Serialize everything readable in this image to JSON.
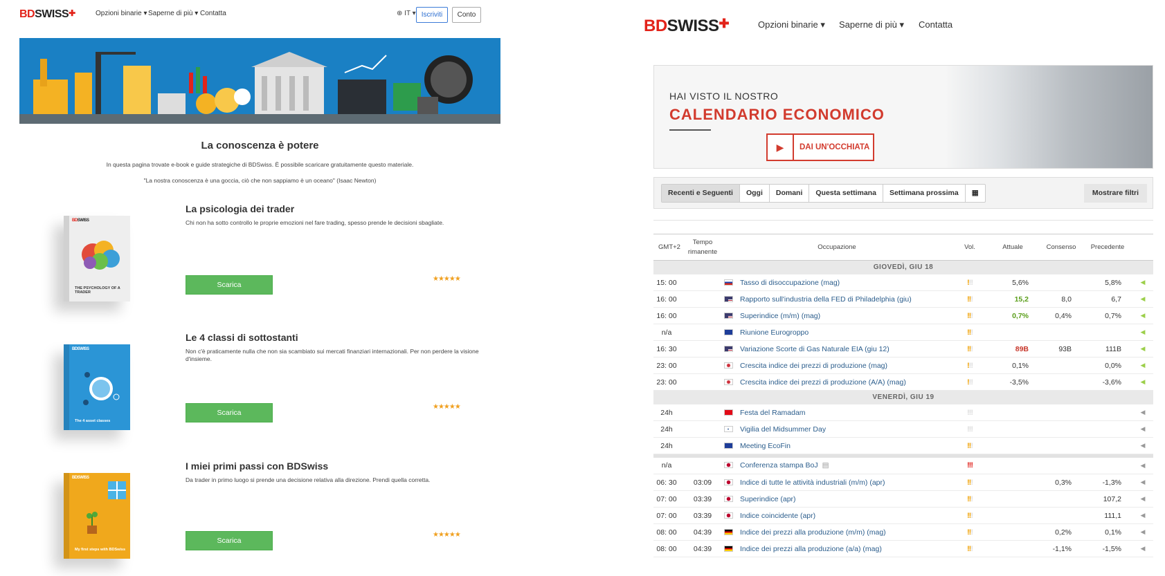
{
  "left": {
    "logo": {
      "bd": "BD",
      "swiss": "SWISS"
    },
    "nav": [
      "Opzioni binarie",
      "Saperne di più",
      "Contatta"
    ],
    "lang": "IT",
    "register_label": "Iscriviti",
    "account_label": "Conto",
    "heading": "La conoscenza è potere",
    "intro": "In questa pagina trovate e-book e guide strategiche di BDSwiss. È possibile scaricare gratuitamente questo materiale.",
    "quote": "\"La nostra conoscenza è una goccia, ciò che non sappiamo è un oceano\" (Isaac Newton)",
    "ebooks": [
      {
        "title": "La psicologia dei trader",
        "desc": "Chi non ha sotto controllo le proprie emozioni nel fare trading, spesso prende le decisioni sbagliate.",
        "button": "Scarica",
        "cover_text": "THE PSYCHOLOGY OF A TRADER",
        "cover_color": "#eeeeee",
        "rating": "★★★★★"
      },
      {
        "title": "Le 4 classi di sottostanti",
        "desc": "Non c'è praticamente nulla che non sia scambiato sui mercati finanziari internazionali. Per non perdere la visione d'insieme.",
        "button": "Scarica",
        "cover_text": "The 4 asset classes",
        "cover_color": "#2b95d6",
        "rating": "★★★★★"
      },
      {
        "title": "I miei primi passi con BDSwiss",
        "desc": "Da trader in primo luogo si prende una decisione relativa alla direzione. Prendi quella corretta.",
        "button": "Scarica",
        "cover_text": "My first steps with BDSwiss",
        "cover_color": "#f0a81c",
        "rating": "★★★★★"
      }
    ]
  },
  "right": {
    "nav": [
      "Opzioni binarie",
      "Saperne di più",
      "Contatta"
    ],
    "promo": {
      "sub": "HAI VISTO IL NOSTRO",
      "main": "CALENDARIO ECONOMICO",
      "cta": "DAI UN'OCCHIATA"
    },
    "filters": [
      "Recenti e Seguenti",
      "Oggi",
      "Domani",
      "Questa settimana",
      "Settimana prossima"
    ],
    "show_filters": "Mostrare filtri",
    "columns": {
      "time": "GMT+2",
      "remaining": "Tempo rimanente",
      "event": "Occupazione",
      "vol": "Vol.",
      "actual": "Attuale",
      "consensus": "Consenso",
      "previous": "Precedente"
    },
    "day1": "GIOVEDÌ, GIU 18",
    "day2": "VENERDÌ, GIU 19",
    "rows1": [
      {
        "time": "15: 00",
        "rem": "",
        "flag": "ru",
        "event": "Tasso di disoccupazione (mag)",
        "vol": 1,
        "actual": "5,6%",
        "actual_cls": "",
        "cons": "",
        "prev": "5,8%"
      },
      {
        "time": "16: 00",
        "rem": "",
        "flag": "us",
        "event": "Rapporto sull'industria della FED di Philadelphia (giu)",
        "vol": 2,
        "actual": "15,2",
        "actual_cls": "pos",
        "cons": "8,0",
        "prev": "6,7"
      },
      {
        "time": "16: 00",
        "rem": "",
        "flag": "us",
        "event": "Superindice (m/m) (mag)",
        "vol": 2,
        "actual": "0,7%",
        "actual_cls": "pos",
        "cons": "0,4%",
        "prev": "0,7%"
      },
      {
        "time": "n/a",
        "rem": "",
        "flag": "eu",
        "event": "Riunione Eurogroppo",
        "vol": 2,
        "actual": "",
        "actual_cls": "",
        "cons": "",
        "prev": ""
      },
      {
        "time": "16: 30",
        "rem": "",
        "flag": "us",
        "event": "Variazione Scorte di Gas Naturale EIA (giu 12)",
        "vol": 2,
        "actual": "89B",
        "actual_cls": "neg",
        "cons": "93B",
        "prev": "111B"
      },
      {
        "time": "23: 00",
        "rem": "",
        "flag": "kr",
        "event": "Crescita indice dei prezzi di produzione (mag)",
        "vol": 1,
        "actual": "0,1%",
        "actual_cls": "",
        "cons": "",
        "prev": "0,0%"
      },
      {
        "time": "23: 00",
        "rem": "",
        "flag": "kr",
        "event": "Crescita indice dei prezzi di produzione (A/A) (mag)",
        "vol": 1,
        "actual": "-3,5%",
        "actual_cls": "",
        "cons": "",
        "prev": "-3,6%"
      }
    ],
    "rows2": [
      {
        "time": "24h",
        "rem": "",
        "flag": "tr",
        "event": "Festa del Ramadam",
        "vol": 0,
        "actual": "",
        "actual_cls": "",
        "cons": "",
        "prev": ""
      },
      {
        "time": "24h",
        "rem": "",
        "flag": "fi",
        "event": "Vigilia del Midsummer Day",
        "vol": 0,
        "actual": "",
        "actual_cls": "",
        "cons": "",
        "prev": ""
      },
      {
        "time": "24h",
        "rem": "",
        "flag": "eu",
        "event": "Meeting EcoFin",
        "vol": 2,
        "actual": "",
        "actual_cls": "",
        "cons": "",
        "prev": ""
      }
    ],
    "rows3": [
      {
        "time": "n/a",
        "rem": "",
        "flag": "jp",
        "event": "Conferenza stampa BoJ",
        "vol": 3,
        "actual": "",
        "actual_cls": "",
        "cons": "",
        "prev": ""
      },
      {
        "time": "06: 30",
        "rem": "03:09",
        "flag": "jp",
        "event": "Indice di tutte le attività industriali (m/m) (apr)",
        "vol": 2,
        "actual": "",
        "actual_cls": "",
        "cons": "0,3%",
        "prev": "-1,3%"
      },
      {
        "time": "07: 00",
        "rem": "03:39",
        "flag": "jp",
        "event": "Superindice (apr)",
        "vol": 2,
        "actual": "",
        "actual_cls": "",
        "cons": "",
        "prev": "107,2"
      },
      {
        "time": "07: 00",
        "rem": "03:39",
        "flag": "jp",
        "event": "Indice coincidente (apr)",
        "vol": 2,
        "actual": "",
        "actual_cls": "",
        "cons": "",
        "prev": "111,1"
      },
      {
        "time": "08: 00",
        "rem": "04:39",
        "flag": "de",
        "event": "Indice dei prezzi alla produzione (m/m) (mag)",
        "vol": 2,
        "actual": "",
        "actual_cls": "",
        "cons": "0,2%",
        "prev": "0,1%"
      },
      {
        "time": "08: 00",
        "rem": "04:39",
        "flag": "de",
        "event": "Indice dei prezzi alla produzione (a/a) (mag)",
        "vol": 2,
        "actual": "",
        "actual_cls": "",
        "cons": "-1,1%",
        "prev": "-1,5%"
      }
    ],
    "colors": {
      "brand_red": "#e2231a",
      "download_green": "#5cb85c",
      "positive": "#5a9e1a",
      "negative": "#c7372b"
    }
  }
}
